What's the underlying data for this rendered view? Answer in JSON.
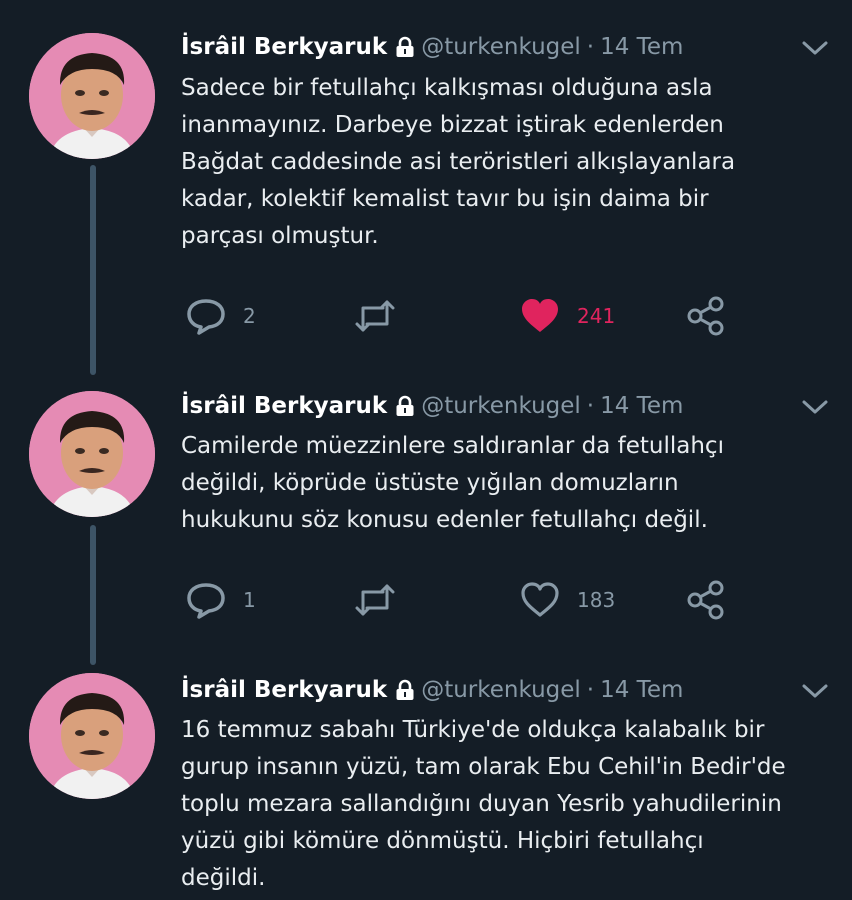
{
  "tweets": [
    {
      "author_name": "İsrâil Berkyaruk",
      "handle": "@turkenkugel",
      "separator": "·",
      "date": "14 Tem",
      "text": "Sadece bir fetullahçı kalkışması olduğuna asla\ninanmayınız. Darbeye bizzat iştirak edenlerden\nBağdat caddesinde asi teröristleri alkışlayanlara\nkadar, kolektif kemalist tavır bu işin daima bir\nparçası olmuştur.",
      "reply_count": "2",
      "retweet_count": "",
      "like_count": "241",
      "liked": true
    },
    {
      "author_name": "İsrâil Berkyaruk",
      "handle": "@turkenkugel",
      "separator": "·",
      "date": "14 Tem",
      "text": "Camilerde müezzinlere saldıranlar da fetullahçı\ndeğildi, köprüde üstüste yığılan domuzların\nhukukunu söz konusu edenler fetullahçı değil.",
      "reply_count": "1",
      "retweet_count": "",
      "like_count": "183",
      "liked": false
    },
    {
      "author_name": "İsrâil Berkyaruk",
      "handle": "@turkenkugel",
      "separator": "·",
      "date": "14 Tem",
      "text": "16 temmuz sabahı Türkiye'de oldukça kalabalık bir\ngurup insanın yüzü, tam olarak Ebu Cehil'in Bedir'de\ntoplu mezara sallandığını duyan Yesrib yahudilerinin\nyüzü gibi kömüre dönmüştü. Hiçbiri fetullahçı\ndeğildi.",
      "reply_count": "",
      "retweet_count": "",
      "like_count": "",
      "liked": false
    }
  ],
  "icons": {
    "protected": "lock-icon",
    "menu": "chevron-down-icon",
    "reply": "reply-icon",
    "retweet": "retweet-icon",
    "like": "heart-icon",
    "share": "share-icon"
  },
  "colors": {
    "background": "#141d26",
    "text": "#e9edf0",
    "secondary": "#8899a6",
    "like_active": "#e0245e",
    "thread_line": "#3d5466",
    "avatar_bg": "#e58bb4"
  }
}
